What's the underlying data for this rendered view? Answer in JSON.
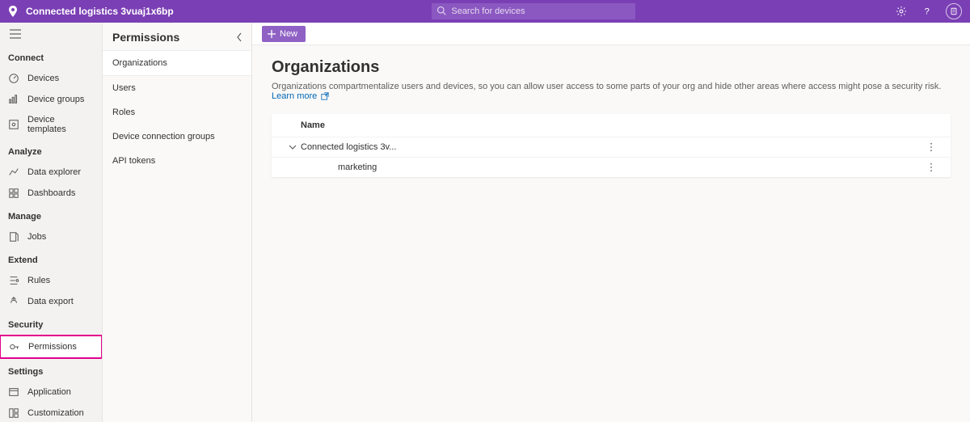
{
  "header": {
    "app_title": "Connected logistics 3vuaj1x6bp",
    "search_placeholder": "Search for devices"
  },
  "nav_groups": [
    {
      "label": "Connect",
      "items": [
        {
          "id": "devices",
          "label": "Devices",
          "icon": "dial-icon"
        },
        {
          "id": "device-groups",
          "label": "Device groups",
          "icon": "barchart-icon"
        },
        {
          "id": "device-templates",
          "label": "Device templates",
          "icon": "template-icon"
        }
      ]
    },
    {
      "label": "Analyze",
      "items": [
        {
          "id": "data-explorer",
          "label": "Data explorer",
          "icon": "line-chart-icon"
        },
        {
          "id": "dashboards",
          "label": "Dashboards",
          "icon": "dashboard-icon"
        }
      ]
    },
    {
      "label": "Manage",
      "items": [
        {
          "id": "jobs",
          "label": "Jobs",
          "icon": "jobs-icon"
        }
      ]
    },
    {
      "label": "Extend",
      "items": [
        {
          "id": "rules",
          "label": "Rules",
          "icon": "rules-icon"
        },
        {
          "id": "data-export",
          "label": "Data export",
          "icon": "export-icon"
        }
      ]
    },
    {
      "label": "Security",
      "items": [
        {
          "id": "permissions",
          "label": "Permissions",
          "icon": "key-icon",
          "active": true,
          "highlighted": true
        }
      ]
    },
    {
      "label": "Settings",
      "items": [
        {
          "id": "application",
          "label": "Application",
          "icon": "app-icon"
        },
        {
          "id": "customization",
          "label": "Customization",
          "icon": "custom-icon"
        }
      ]
    }
  ],
  "secondary_panel": {
    "title": "Permissions",
    "items": [
      {
        "id": "organizations",
        "label": "Organizations",
        "active": true
      },
      {
        "id": "users",
        "label": "Users"
      },
      {
        "id": "roles",
        "label": "Roles"
      },
      {
        "id": "device-connection-groups",
        "label": "Device connection groups"
      },
      {
        "id": "api-tokens",
        "label": "API tokens"
      }
    ]
  },
  "command_bar": {
    "new_label": "New"
  },
  "page": {
    "title": "Organizations",
    "description": "Organizations compartmentalize users and devices, so you can allow user access to some parts of your org and hide other areas where access might pose a security risk.",
    "learn_more": "Learn more"
  },
  "table": {
    "columns": {
      "name": "Name"
    },
    "rows": [
      {
        "name": "Connected logistics 3v...",
        "level": 0,
        "expanded": true
      },
      {
        "name": "marketing",
        "level": 1
      }
    ]
  }
}
